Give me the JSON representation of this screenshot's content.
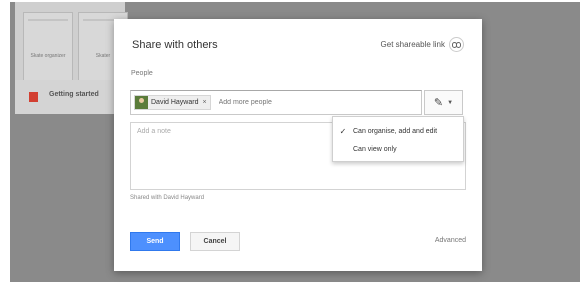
{
  "background": {
    "thumbnail_captions": [
      "Skate organizer",
      "Skater"
    ],
    "doc_label": "Getting started"
  },
  "dialog": {
    "title": "Share with others",
    "shareable_link_label": "Get shareable link",
    "shareable_link_icon": "link-icon",
    "people_label": "People",
    "recipient": {
      "name": "David Hayward",
      "remove_glyph": "×"
    },
    "add_people_placeholder": "Add more people",
    "permission_button_icon": "pencil-icon",
    "permission_options": [
      {
        "label": "Can organise, add and edit",
        "selected": true
      },
      {
        "label": "Can view only",
        "selected": false
      }
    ],
    "note_placeholder": "Add a note",
    "shared_with_text": "Shared with David Hayward",
    "send_label": "Send",
    "cancel_label": "Cancel",
    "advanced_label": "Advanced"
  },
  "colors": {
    "primary_button": "#4d90fe",
    "overlay": "#8a8a8a"
  }
}
